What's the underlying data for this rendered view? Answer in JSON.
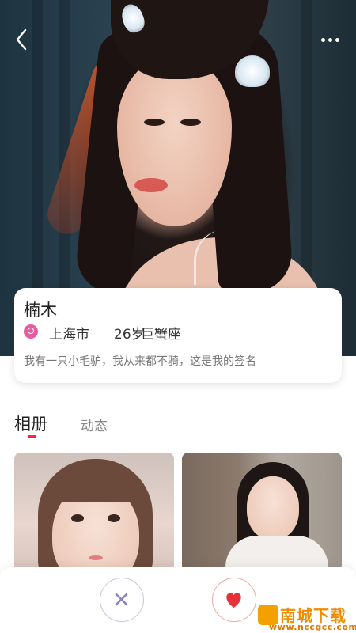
{
  "profile": {
    "name": "楠木",
    "city": "上海市",
    "age": "26岁",
    "zodiac": "巨蟹座",
    "signature": "我有一只小毛驴，我从来都不骑，这是我的签名"
  },
  "tabs": [
    {
      "label": "相册",
      "active": true
    },
    {
      "label": "动态",
      "active": false
    }
  ],
  "icons": {
    "back": "back-arrow-icon",
    "more": "more-dots-icon",
    "location": "location-pin-icon",
    "dislike": "close-x-icon",
    "like": "heart-icon"
  },
  "colors": {
    "accent": "#e8303a",
    "location_icon": "#e85da1",
    "dislike_border": "#c9c3de",
    "like_border": "#f0a6a6"
  },
  "watermark": {
    "title": "南城下载",
    "url": "www.nccgcc.com"
  }
}
